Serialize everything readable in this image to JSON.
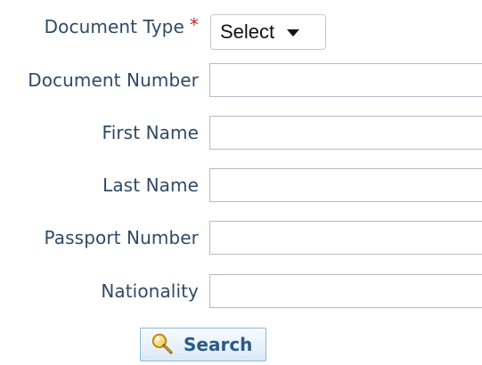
{
  "form": {
    "document_type": {
      "label": "Document Type",
      "required_mark": "*",
      "selected_value": "Select"
    },
    "fields": [
      {
        "label": "Document Number",
        "value": "",
        "placeholder": ""
      },
      {
        "label": "First Name",
        "value": "",
        "placeholder": ""
      },
      {
        "label": "Last Name",
        "value": "",
        "placeholder": ""
      },
      {
        "label": "Passport Number",
        "value": "",
        "placeholder": ""
      },
      {
        "label": "Nationality",
        "value": "",
        "placeholder": ""
      }
    ],
    "search_button": {
      "label": "Search",
      "icon": "search-icon"
    }
  },
  "colors": {
    "label_text": "#2f4a66",
    "required": "#c62828",
    "input_border": "#b9b9c9",
    "button_border": "#8cb7d9",
    "button_text": "#2b5a86"
  }
}
